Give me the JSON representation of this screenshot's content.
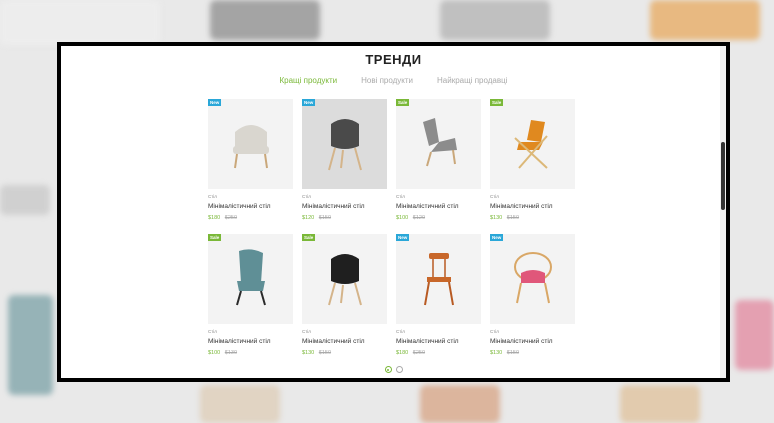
{
  "section_title": "ТРЕНДИ",
  "tabs": [
    {
      "label": "Кращі продукти",
      "active": true
    },
    {
      "label": "Нові продукти",
      "active": false
    },
    {
      "label": "Найкращі продавці",
      "active": false
    }
  ],
  "products": [
    {
      "badge": "New",
      "badge_type": "new",
      "category": "Стіл",
      "name": "Мінімалістичний стіл",
      "price": "$180",
      "old_price": "$250",
      "icon": "armchair-beige-icon",
      "seat_color": "#d9d6cf",
      "leg_color": "#c9a77a"
    },
    {
      "badge": "New",
      "badge_type": "new",
      "category": "Стіл",
      "name": "Мінімалістичний стіл",
      "price": "$120",
      "old_price": "$150",
      "icon": "shell-chair-grey-icon",
      "seat_color": "#4a4a4a",
      "leg_color": "#d4b48a"
    },
    {
      "badge": "Sale",
      "badge_type": "sale",
      "category": "Стіл",
      "name": "Мінімалістичний стіл",
      "price": "$100",
      "old_price": "$120",
      "icon": "wingback-chair-grey-icon",
      "seat_color": "#8c8c8c",
      "leg_color": "#c9a77a"
    },
    {
      "badge": "Sale",
      "badge_type": "sale",
      "category": "Стіл",
      "name": "Мінімалістичний стіл",
      "price": "$130",
      "old_price": "$150",
      "icon": "lounge-chair-orange-icon",
      "seat_color": "#e0891f",
      "leg_color": "#dcb878"
    },
    {
      "badge": "Sale",
      "badge_type": "sale",
      "category": "Стіл",
      "name": "Мінімалістичний стіл",
      "price": "$100",
      "old_price": "$130",
      "icon": "highback-chair-teal-icon",
      "seat_color": "#5f8f96",
      "leg_color": "#2a2a2a"
    },
    {
      "badge": "Sale",
      "badge_type": "sale",
      "category": "Стіл",
      "name": "Мінімалістичний стіл",
      "price": "$130",
      "old_price": "$150",
      "icon": "shell-chair-black-icon",
      "seat_color": "#1f1f1f",
      "leg_color": "#d4b48a"
    },
    {
      "badge": "New",
      "badge_type": "new",
      "category": "Стіл",
      "name": "Мінімалістичний стіл",
      "price": "$180",
      "old_price": "$250",
      "icon": "wood-chair-orange-icon",
      "seat_color": "#c8672a",
      "leg_color": "#b85a22"
    },
    {
      "badge": "New",
      "badge_type": "new",
      "category": "Стіл",
      "name": "Мінімалістичний стіл",
      "price": "$130",
      "old_price": "$150",
      "icon": "rattan-chair-pink-icon",
      "seat_color": "#e0577a",
      "leg_color": "#d9a766"
    }
  ],
  "pagination": {
    "active_index": 0,
    "count": 2
  }
}
